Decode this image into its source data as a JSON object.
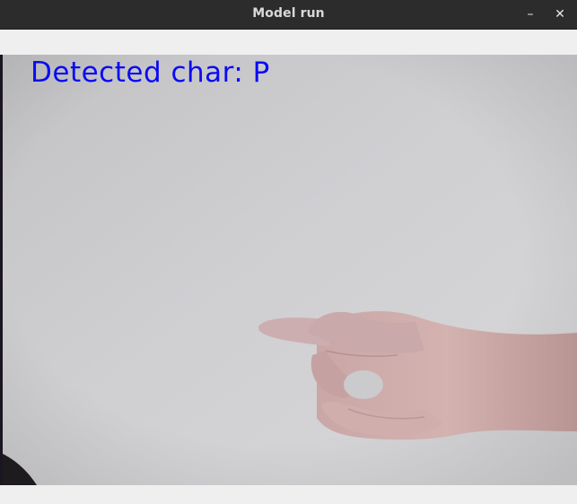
{
  "window": {
    "title": "Model run",
    "minimize_symbol": "–",
    "close_symbol": "✕"
  },
  "video": {
    "overlay_label": "Detected char: P",
    "overlay_color": "#0b0bf4"
  }
}
